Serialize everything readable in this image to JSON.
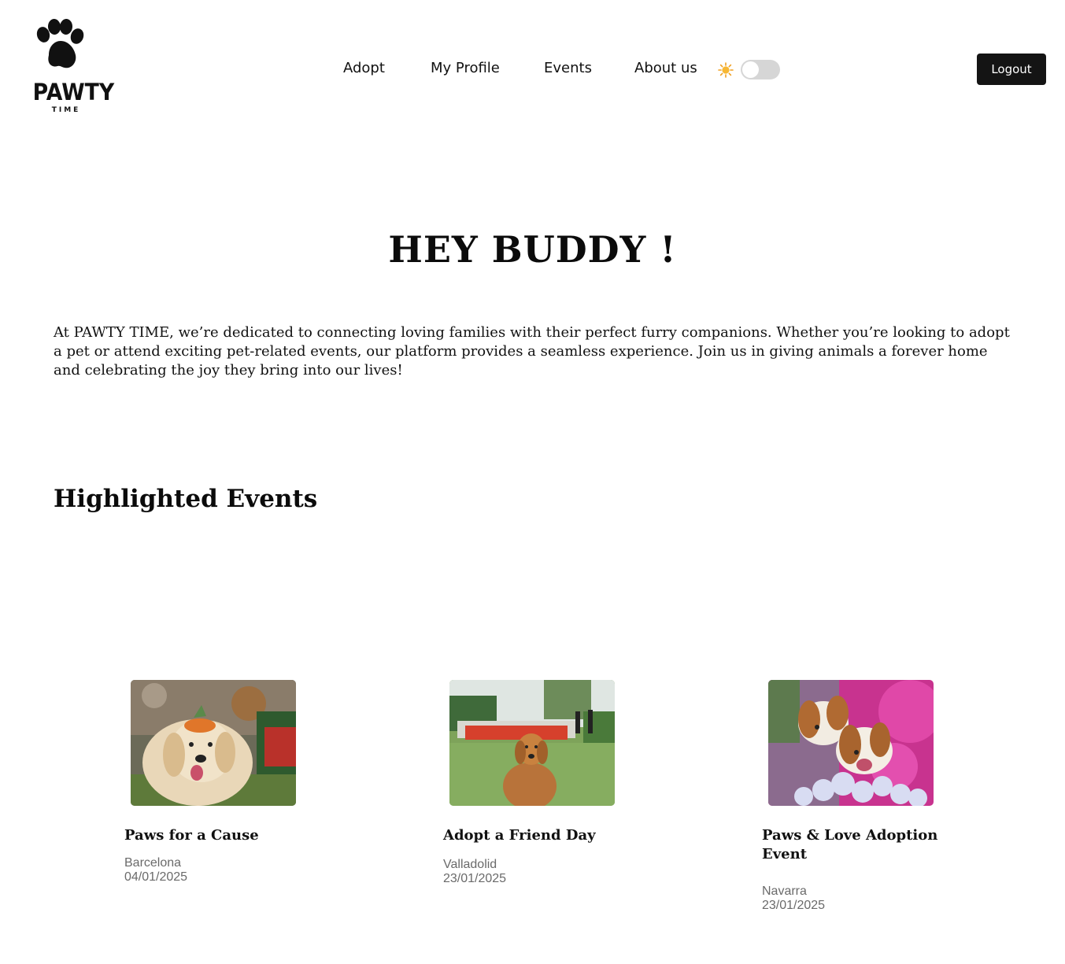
{
  "brand": {
    "name": "PAWTY",
    "tagline": "TIME"
  },
  "nav": {
    "links": [
      {
        "label": "Adopt"
      },
      {
        "label": "My Profile"
      },
      {
        "label": "Events"
      },
      {
        "label": "About us"
      }
    ],
    "theme_icon": "sun-icon",
    "theme_toggle_on": false,
    "logout_label": "Logout"
  },
  "hero": {
    "title": "HEY BUDDY !",
    "intro": "At PAWTY TIME, we’re dedicated to connecting loving families with their perfect furry companions. Whether you’re looking to adopt a pet or attend exciting pet-related events, our platform provides a seamless experience. Join us in giving animals a forever home and celebrating the joy they bring into our lives!"
  },
  "highlighted": {
    "title": "Highlighted Events",
    "events": [
      {
        "title": "Paws for a Cause",
        "location": "Barcelona",
        "date": "04/01/2025"
      },
      {
        "title": "Adopt a Friend Day",
        "location": "Valladolid",
        "date": "23/01/2025"
      },
      {
        "title": "Paws & Love Adoption Event",
        "location": "Navarra",
        "date": "23/01/2025"
      }
    ]
  },
  "colors": {
    "accent": "#141414",
    "muted_text": "#6a6a6a",
    "toggle_track": "#d6d6d6"
  }
}
